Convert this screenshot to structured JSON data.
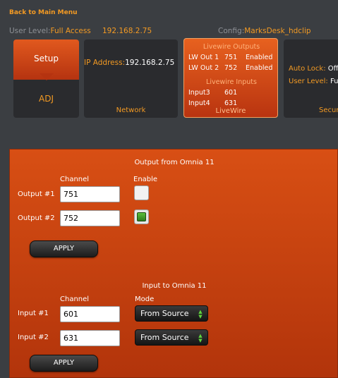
{
  "header": {
    "back_link": "Back to Main Menu",
    "user_level_label": "User Level:",
    "user_level_value": "Full Access",
    "ip": "192.168.2.75",
    "config_label": "Config:",
    "config_value": "MarksDesk_hdclip"
  },
  "tiles": {
    "setup": {
      "top_label": "Setup",
      "bottom_label": "ADJ"
    },
    "network": {
      "ip_label": "IP Address:",
      "ip_value": "192.168.2.75",
      "footer": "Network"
    },
    "livewire": {
      "outputs_title": "Livewire Outputs",
      "outputs": [
        {
          "name": "LW Out 1",
          "channel": "751",
          "status": "Enabled"
        },
        {
          "name": "LW Out 2",
          "channel": "752",
          "status": "Enabled"
        }
      ],
      "inputs_title": "Livewire Inputs",
      "inputs": [
        {
          "name": "Input3",
          "channel": "601"
        },
        {
          "name": "Input4",
          "channel": "631"
        }
      ],
      "footer": "LiveWire"
    },
    "security": {
      "auto_lock_label": "Auto Lock:",
      "auto_lock_value": "Off",
      "user_level_label": "User Level:",
      "user_level_value": "Full",
      "footer": "Secur"
    }
  },
  "output_section": {
    "title": "Output from Omnia 11",
    "channel_header": "Channel",
    "enable_header": "Enable",
    "rows": [
      {
        "label": "Output #1",
        "channel": "751",
        "enabled": false
      },
      {
        "label": "Output #2",
        "channel": "752",
        "enabled": true
      }
    ],
    "apply_label": "APPLY"
  },
  "input_section": {
    "title": "Input to Omnia 11",
    "channel_header": "Channel",
    "mode_header": "Mode",
    "rows": [
      {
        "label": "Input #1",
        "channel": "601",
        "mode": "From Source"
      },
      {
        "label": "Input #2",
        "channel": "631",
        "mode": "From Source"
      }
    ],
    "apply_label": "APPLY"
  },
  "colors": {
    "accent": "#f39a23",
    "panel": "#d04a12",
    "enabled_green": "#4aa32d",
    "background": "#3b3e42"
  }
}
